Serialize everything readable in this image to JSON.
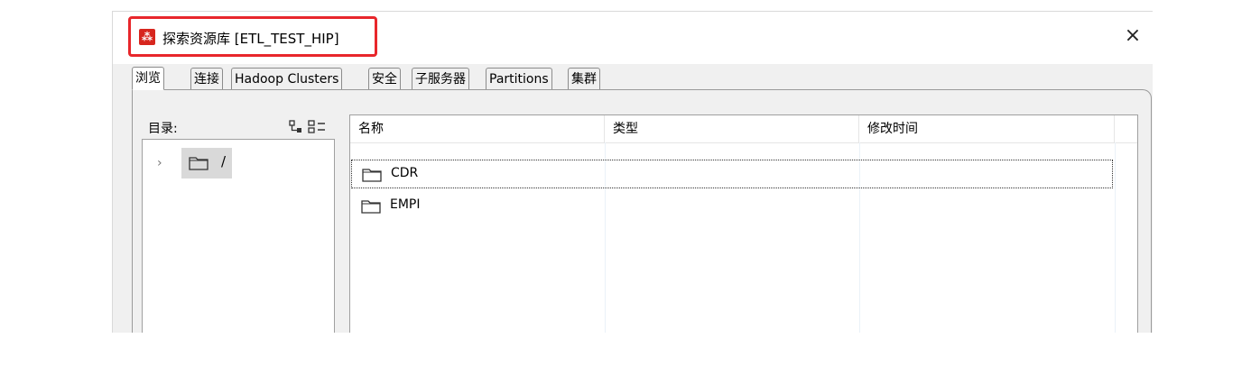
{
  "window": {
    "title": "探索资源库 [ETL_TEST_HIP]",
    "app_icon": "kettle-app-icon",
    "close_label": "×"
  },
  "tabs": [
    {
      "label": "浏览",
      "active": true
    },
    {
      "label": "连接",
      "active": false
    },
    {
      "label": "Hadoop Clusters",
      "active": false
    },
    {
      "label": "安全",
      "active": false
    },
    {
      "label": "子服务器",
      "active": false
    },
    {
      "label": "Partitions",
      "active": false
    },
    {
      "label": "集群",
      "active": false
    }
  ],
  "tree": {
    "label": "目录:",
    "toolbar_icon": "tree-view-toggle-icon",
    "expander": "›",
    "root": {
      "label": "/",
      "icon": "folder-icon"
    }
  },
  "files": {
    "columns": [
      "名称",
      "类型",
      "修改时间"
    ],
    "rows": [
      {
        "name": "CDR",
        "type": "",
        "modified": "",
        "icon": "folder-icon",
        "selected": true
      },
      {
        "name": "EMPI",
        "type": "",
        "modified": "",
        "icon": "folder-icon",
        "selected": false
      }
    ]
  },
  "colors": {
    "highlight": "#e8262b",
    "app_icon": "#d7261e"
  }
}
